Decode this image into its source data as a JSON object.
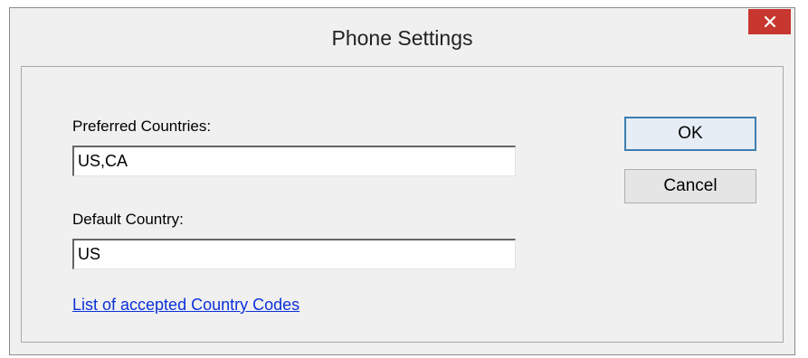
{
  "dialog": {
    "title": "Phone Settings",
    "close_glyph": "✕"
  },
  "form": {
    "preferred_label": "Preferred Countries:",
    "preferred_value": "US,CA",
    "default_label": "Default Country:",
    "default_value": "US",
    "codes_link": "List of accepted Country Codes"
  },
  "buttons": {
    "ok_label": "OK",
    "cancel_label": "Cancel"
  },
  "icons": {
    "close": "close-icon"
  },
  "colors": {
    "close_button": "#c7372f",
    "link": "#0b31d9",
    "default_button_border": "#3c7fb1"
  }
}
